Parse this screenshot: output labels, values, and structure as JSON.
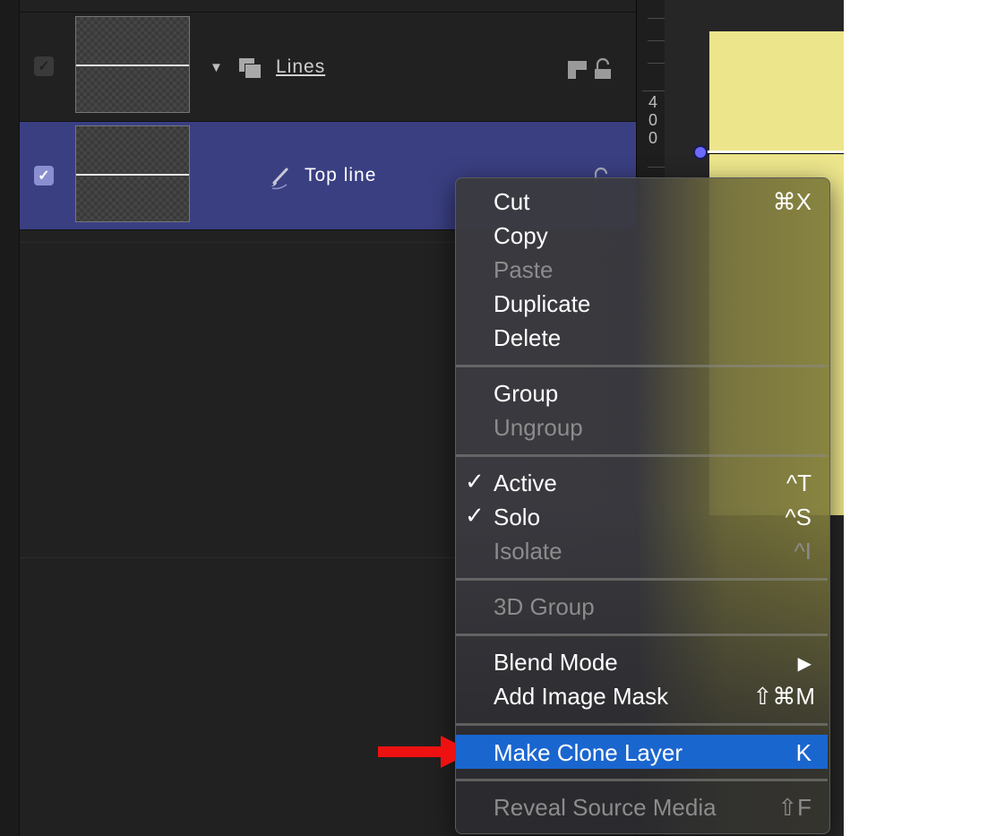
{
  "layers": [
    {
      "name": "Lines",
      "type": "group",
      "checked": true
    },
    {
      "name": "Top line",
      "type": "shape",
      "checked": true,
      "selected": true
    }
  ],
  "ruler": {
    "label": "400",
    "digits": [
      "4",
      "0",
      "0"
    ]
  },
  "context_menu": {
    "sections": [
      [
        {
          "label": "Cut",
          "shortcut": "⌘X",
          "enabled": true
        },
        {
          "label": "Copy",
          "shortcut": "",
          "enabled": true
        },
        {
          "label": "Paste",
          "shortcut": "",
          "enabled": false
        },
        {
          "label": "Duplicate",
          "shortcut": "",
          "enabled": true
        },
        {
          "label": "Delete",
          "shortcut": "",
          "enabled": true
        }
      ],
      [
        {
          "label": "Group",
          "shortcut": "",
          "enabled": true
        },
        {
          "label": "Ungroup",
          "shortcut": "",
          "enabled": false
        }
      ],
      [
        {
          "label": "Active",
          "shortcut": "^T",
          "enabled": true,
          "checked": true
        },
        {
          "label": "Solo",
          "shortcut": "^S",
          "enabled": true,
          "checked": true
        },
        {
          "label": "Isolate",
          "shortcut": "^I",
          "enabled": false
        }
      ],
      [
        {
          "label": "3D Group",
          "shortcut": "",
          "enabled": false
        }
      ],
      [
        {
          "label": "Blend Mode",
          "shortcut": "▶",
          "enabled": true,
          "submenu": true
        },
        {
          "label": "Add Image Mask",
          "shortcut": "⇧⌘M",
          "enabled": true
        }
      ],
      [
        {
          "label": "Make Clone Layer",
          "shortcut": "K",
          "enabled": true,
          "highlighted": true
        }
      ],
      [
        {
          "label": "Reveal Source Media",
          "shortcut": "⇧F",
          "enabled": false
        }
      ]
    ],
    "check_glyph": "✓"
  },
  "colors": {
    "selection": "#3a3f82",
    "menu_highlight": "#1a66cf",
    "canvas_yellow": "#ece58c",
    "arrow": "#ee1111"
  },
  "icons": {
    "disclosure": "disclosure-triangle-icon",
    "group": "group-layers-icon",
    "brush": "paint-brush-icon",
    "lock": "lock-icon",
    "arrow": "red-arrow-icon"
  }
}
